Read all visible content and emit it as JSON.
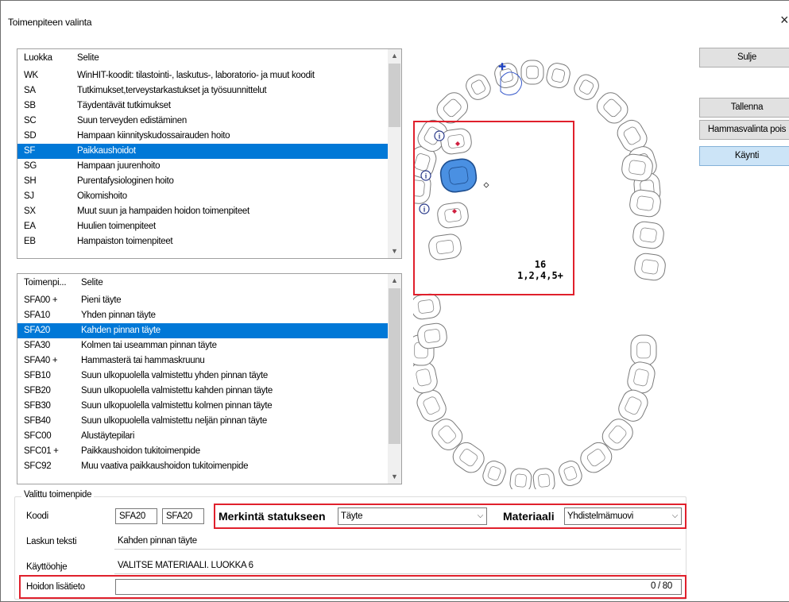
{
  "window": {
    "title": "Toimenpiteen valinta",
    "close": "×"
  },
  "classes": {
    "headers": [
      "Luokka",
      "Selite"
    ],
    "rows": [
      {
        "code": "WK",
        "desc": "WinHIT-koodit: tilastointi-, laskutus-, laboratorio- ja muut koodit"
      },
      {
        "code": "SA",
        "desc": "Tutkimukset,terveystarkastukset ja työsuunnittelut"
      },
      {
        "code": "SB",
        "desc": "Täydentävät tutkimukset"
      },
      {
        "code": "SC",
        "desc": "Suun terveyden edistäminen"
      },
      {
        "code": "SD",
        "desc": "Hampaan kiinnityskudossairauden hoito"
      },
      {
        "code": "SF",
        "desc": "Paikkaushoidot"
      },
      {
        "code": "SG",
        "desc": "Hampaan juurenhoito"
      },
      {
        "code": "SH",
        "desc": "Purentafysiologinen hoito"
      },
      {
        "code": "SJ",
        "desc": "Oikomishoito"
      },
      {
        "code": "SX",
        "desc": "Muut suun ja hampaiden hoidon toimenpiteet"
      },
      {
        "code": "EA",
        "desc": "Huulien toimenpiteet"
      },
      {
        "code": "EB",
        "desc": "Hampaiston toimenpiteet"
      }
    ],
    "selected": "SF"
  },
  "procedures": {
    "headers": [
      "Toimenpi...",
      "Selite"
    ],
    "rows": [
      {
        "code": "SFA00 +",
        "desc": "Pieni täyte"
      },
      {
        "code": "SFA10",
        "desc": "Yhden pinnan täyte"
      },
      {
        "code": "SFA20",
        "desc": "Kahden pinnan täyte"
      },
      {
        "code": "SFA30",
        "desc": "Kolmen tai useamman pinnan täyte"
      },
      {
        "code": "SFA40 +",
        "desc": "Hammasterä tai hammaskruunu"
      },
      {
        "code": "SFB10",
        "desc": "Suun ulkopuolella valmistettu yhden pinnan täyte"
      },
      {
        "code": "SFB20",
        "desc": "Suun ulkopuolella valmistettu kahden pinnan täyte"
      },
      {
        "code": "SFB30",
        "desc": "Suun ulkopuolella valmistettu kolmen pinnan täyte"
      },
      {
        "code": "SFB40",
        "desc": "Suun ulkopuolella valmistettu neljän pinnan täyte"
      },
      {
        "code": "SFC00",
        "desc": "Alustäytepilari"
      },
      {
        "code": "SFC01 +",
        "desc": "Paikkaushoidon tukitoimenpide"
      },
      {
        "code": "SFC92",
        "desc": "Muu vaativa paikkaushoidon tukitoimenpide"
      }
    ],
    "selected": "SFA20"
  },
  "buttons": {
    "close": "Sulje",
    "save": "Tallenna",
    "tooth_off": "Hammasvalinta pois",
    "visit": "Käynti"
  },
  "chart": {
    "tooth_number": "16",
    "surfaces": "1,2,4,5+",
    "info_icon": "i",
    "plus": "✚"
  },
  "selected": {
    "legend": "Valittu toimenpide",
    "code_label": "Koodi",
    "code1": "SFA20",
    "code2": "SFA20",
    "status_label": "Merkintä statukseen",
    "status_value": "Täyte",
    "material_label": "Materiaali",
    "material_value": "Yhdistelmämuovi",
    "invoice_label": "Laskun teksti",
    "invoice_value": "Kahden pinnan täyte",
    "usage_label": "Käyttöohje",
    "usage_value": "VALITSE MATERIAALI. LUOKKA 6",
    "extra_label": "Hoidon lisätieto",
    "extra_value": "",
    "extra_counter": "0 / 80"
  },
  "colors": {
    "selection": "#0078d7",
    "highlight": "#e0202c",
    "tooth_selected": "#4a90e2"
  }
}
